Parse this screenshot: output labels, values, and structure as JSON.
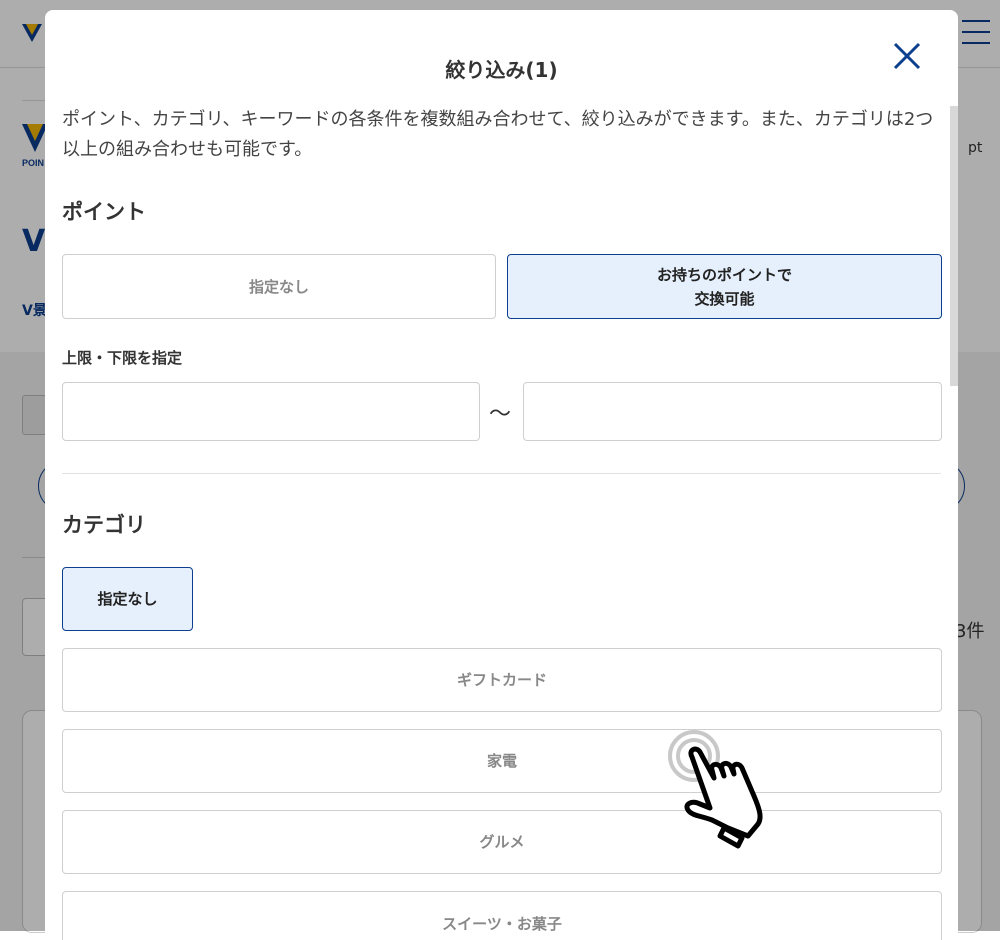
{
  "background": {
    "pt_label": "pt",
    "title_partial": "V",
    "sub_partial": "V景",
    "count_partial": "3件",
    "brand_color": "#0d3f8f",
    "accent_color": "#f2b705"
  },
  "modal": {
    "title": "絞り込み(1)",
    "close_icon": "close-icon",
    "description": "ポイント、カテゴリ、キーワードの各条件を複数組み合わせて、絞り込みができます。また、カテゴリは2つ以上の組み合わせも可能です。",
    "point_section": {
      "title": "ポイント",
      "options": [
        {
          "label": "指定なし",
          "selected": false
        },
        {
          "label_line1": "お持ちのポイントで",
          "label_line2": "交換可能",
          "selected": true
        }
      ],
      "range_label": "上限・下限を指定",
      "range_separator": "〜",
      "min_value": "",
      "max_value": ""
    },
    "category_section": {
      "title": "カテゴリ",
      "none_option": {
        "label": "指定なし",
        "selected": true
      },
      "items": [
        {
          "label": "ギフトカード"
        },
        {
          "label": "家電"
        },
        {
          "label": "グルメ"
        },
        {
          "label": "スイーツ・お菓子"
        }
      ]
    }
  }
}
